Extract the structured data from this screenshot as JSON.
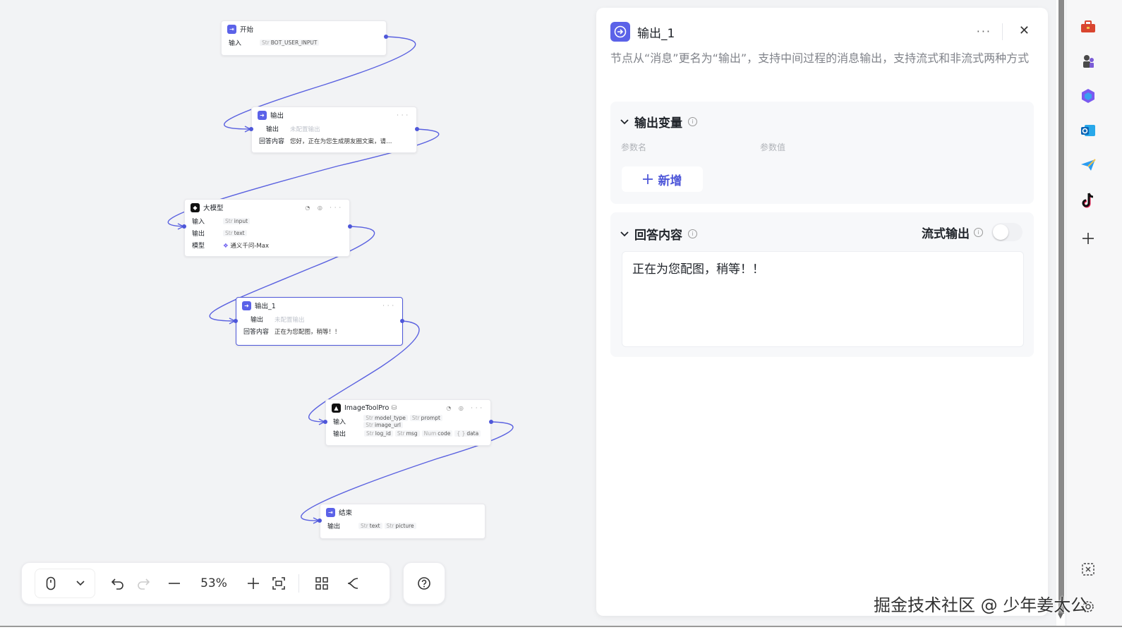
{
  "canvas": {
    "nodes": {
      "start": {
        "title": "开始",
        "rows": [
          {
            "key": "输入",
            "tags": [
              {
                "type": "Str",
                "name": "BOT_USER_INPUT"
              }
            ]
          }
        ]
      },
      "output": {
        "title": "输出",
        "rows": [
          {
            "key": "输出",
            "placeholder": "未配置输出"
          },
          {
            "key": "回答内容",
            "value": "您好，正在为您生成朋友圈文案，请…"
          }
        ]
      },
      "llm": {
        "title": "大模型",
        "rows": [
          {
            "key": "输入",
            "tags": [
              {
                "type": "Str",
                "name": "input"
              }
            ]
          },
          {
            "key": "输出",
            "tags": [
              {
                "type": "Str",
                "name": "text"
              }
            ]
          },
          {
            "key": "模型",
            "value": "通义千问-Max"
          }
        ]
      },
      "output1": {
        "title": "输出_1",
        "rows": [
          {
            "key": "输出",
            "placeholder": "未配置输出"
          },
          {
            "key": "回答内容",
            "value": "正在为您配图，稍等！！"
          }
        ]
      },
      "imagetool": {
        "title": "ImageToolPro",
        "rows": [
          {
            "key": "输入",
            "tags": [
              {
                "type": "Str",
                "name": "model_type"
              },
              {
                "type": "Str",
                "name": "prompt"
              },
              {
                "type": "Str",
                "name": "image_url"
              }
            ]
          },
          {
            "key": "输出",
            "tags": [
              {
                "type": "Str",
                "name": "log_id"
              },
              {
                "type": "Str",
                "name": "msg"
              },
              {
                "type": "Num",
                "name": "code"
              },
              {
                "type": "{ }",
                "name": "data"
              }
            ]
          }
        ]
      },
      "end": {
        "title": "结束",
        "rows": [
          {
            "key": "输出",
            "tags": [
              {
                "type": "Str",
                "name": "text"
              },
              {
                "type": "Str",
                "name": "picture"
              }
            ]
          }
        ]
      }
    }
  },
  "toolbar": {
    "zoom": "53%"
  },
  "panel": {
    "title": "输出_1",
    "more": "···",
    "close": "✕",
    "description": "节点从“消息”更名为“输出”，支持中间过程的消息输出，支持流式和非流式两种方式",
    "output_vars": {
      "title": "输出变量",
      "col_name": "参数名",
      "col_value": "参数值",
      "add_label": "新增"
    },
    "answer": {
      "title": "回答内容",
      "stream_label": "流式输出",
      "stream_on": false,
      "content": "正在为您配图，稍等！！"
    }
  },
  "watermark": "掘金技术社区 @ 少年姜太公",
  "colors": {
    "accent": "#4e57d9",
    "node_icon": "#5b62e8"
  }
}
